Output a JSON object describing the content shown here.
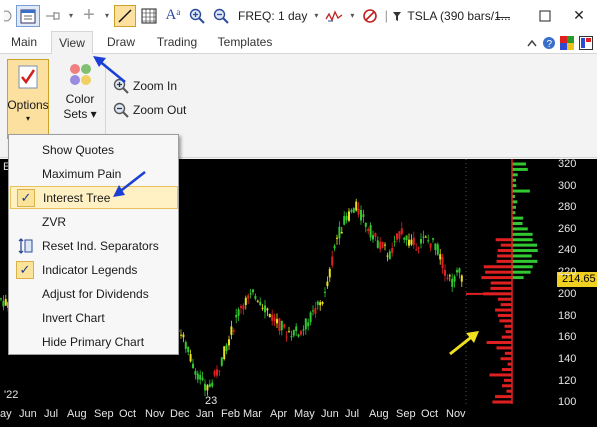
{
  "toolbar": {
    "freq_label": "FREQ: 1 day",
    "window_title": "TSLA (390 bars/1..."
  },
  "tabs": [
    "Main",
    "View",
    "Draw",
    "Trading",
    "Templates"
  ],
  "ribbon": {
    "options_label": "Options",
    "color_sets_line1": "Color",
    "color_sets_line2": "Sets",
    "zoom_in": "Zoom In",
    "zoom_out": "Zoom Out"
  },
  "menu": {
    "items": [
      {
        "label": "Show Quotes",
        "checked": false
      },
      {
        "label": "Maximum Pain",
        "checked": false
      },
      {
        "label": "Interest Tree",
        "checked": true,
        "highlighted": true
      },
      {
        "label": "ZVR",
        "checked": false
      },
      {
        "label": "Reset Ind. Separators",
        "checked": false
      },
      {
        "label": "Indicator Legends",
        "checked": true
      },
      {
        "label": "Adjust for Dividends",
        "checked": false
      },
      {
        "label": "Invert Chart",
        "checked": false
      },
      {
        "label": "Hide Primary Chart",
        "checked": false
      }
    ]
  },
  "chart": {
    "y_ticks": [
      "320",
      "300",
      "280",
      "260",
      "240",
      "220",
      "200",
      "180",
      "160",
      "140",
      "120",
      "100"
    ],
    "x_ticks": [
      "ay",
      "Jun",
      "Jul",
      "Aug",
      "Sep",
      "Oct",
      "Nov",
      "Dec",
      "Jan",
      "Feb",
      "Mar",
      "Apr",
      "May",
      "Jun",
      "Jul",
      "Aug",
      "Sep",
      "Oct",
      "Nov"
    ],
    "year_label_left": "'22",
    "year_label_jan": "23",
    "price_badge": "214.65",
    "left_letter": "E"
  },
  "colors": {
    "accent_blue": "#1a3fd6",
    "annotation_yellow": "#f0e020",
    "bull_candle": "#32c832",
    "bear_candle": "#e02020",
    "candle_yellow": "#e8e020"
  }
}
